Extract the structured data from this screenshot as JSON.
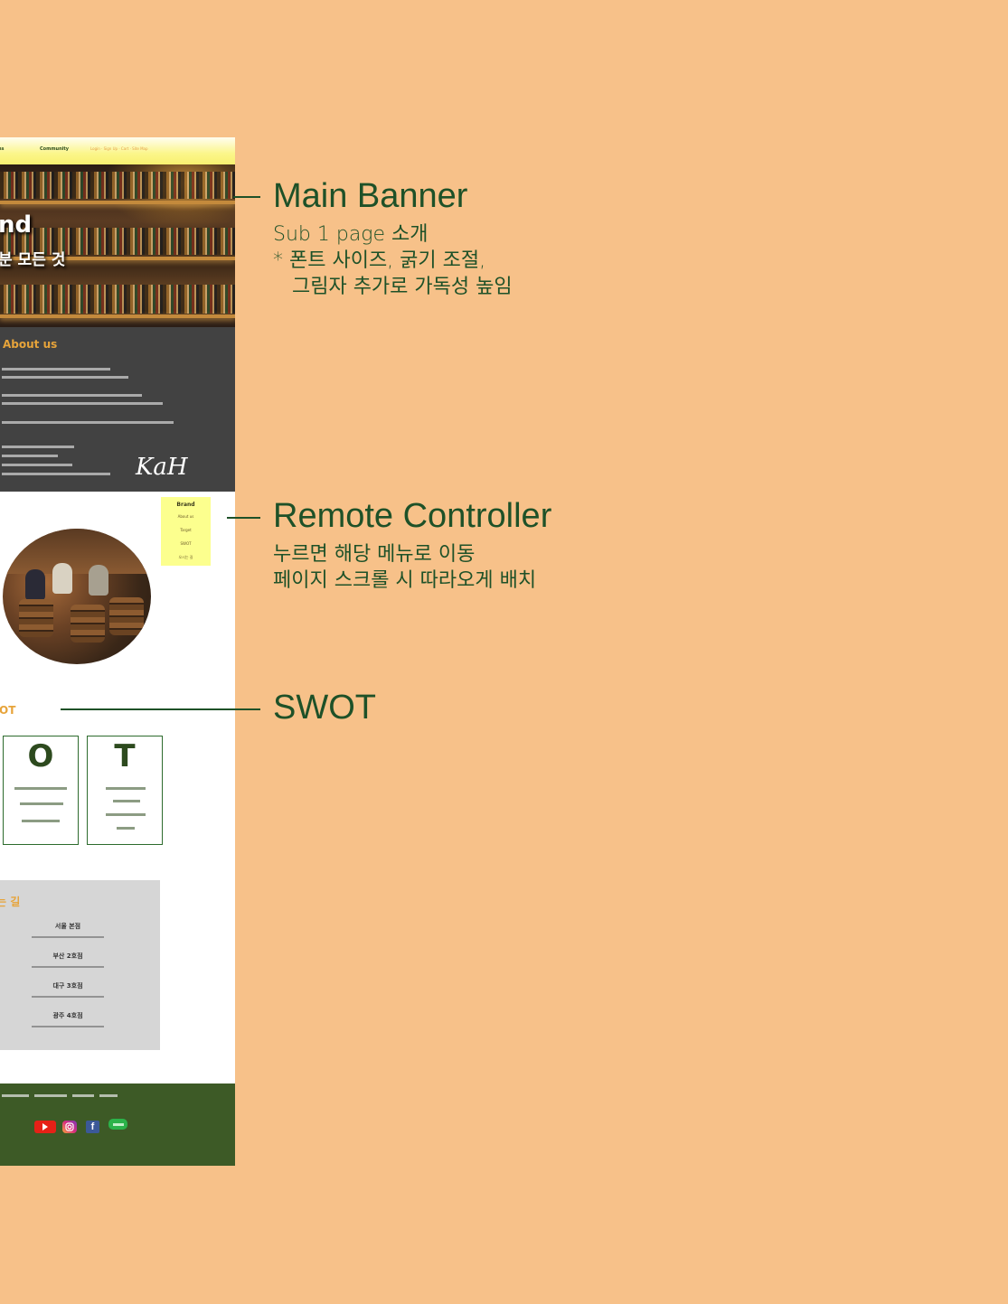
{
  "mockup": {
    "nav": {
      "item1": "ns",
      "item2": "Community",
      "links": "Login · Sign Up · Cart · Site Map"
    },
    "banner": {
      "title": "nd",
      "subtitle": "분 모든 것"
    },
    "about": {
      "heading": "About us",
      "logo": "KaH"
    },
    "remote": {
      "items": [
        "Brand",
        "About us",
        "Target",
        "SWOT",
        "오시는 길"
      ]
    },
    "swot": {
      "heading": "OT",
      "cards": [
        {
          "letter": "O"
        },
        {
          "letter": "T"
        }
      ]
    },
    "locations": {
      "heading": "는 길",
      "items": [
        "서울 본점",
        "부산 2호점",
        "대구 3호점",
        "광주 4호점"
      ]
    },
    "footer": {
      "social": [
        "youtube-icon",
        "instagram-icon",
        "facebook-icon",
        "line-icon"
      ]
    }
  },
  "annotations": {
    "main_banner": {
      "title": "Main Banner",
      "lines": [
        "Sub 1 page 소개",
        "* 폰트 사이즈, 굵기 조절,",
        "   그림자 추가로 가독성 높임"
      ]
    },
    "remote": {
      "title": "Remote Controller",
      "lines": [
        "누르면 해당 메뉴로 이동",
        "페이지 스크롤 시 따라오게 배치"
      ]
    },
    "swot": {
      "title": "SWOT"
    }
  },
  "colors": {
    "background": "#f7c189",
    "annotation": "#1e5128",
    "accent": "#e7a43a",
    "footer": "#3d5a26",
    "remote": "#fcff8e"
  }
}
